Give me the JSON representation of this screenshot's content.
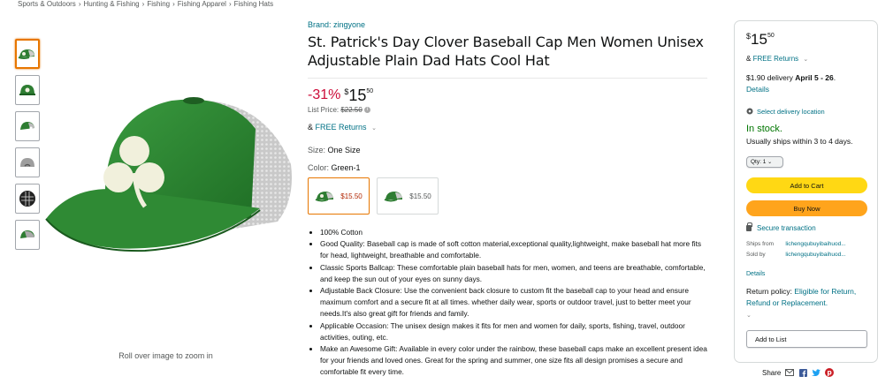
{
  "breadcrumb": [
    "Sports & Outdoors",
    "Hunting & Fishing",
    "Fishing",
    "Fishing Apparel",
    "Fishing Hats"
  ],
  "breadcrumb_sep": "›",
  "thumbnails": [
    "thumb-front",
    "thumb-clover",
    "thumb-side",
    "thumb-back",
    "thumb-inside",
    "thumb-back-gray"
  ],
  "main_image": {
    "rollover_text": "Roll over image to zoom in"
  },
  "product": {
    "brand": "Brand: zingyone",
    "title": "St. Patrick's Day Clover Baseball Cap Men Women Unisex Adjustable Plain Dad Hats Cool Hat",
    "discount": "-31%",
    "price_symbol": "$",
    "price_whole": "15",
    "price_fraction": "50",
    "list_price_label": "List Price:",
    "list_price": "$22.50",
    "returns_amp": "&",
    "returns_link": "FREE Returns",
    "size_label": "Size:",
    "size_value": "One Size",
    "color_label": "Color:",
    "color_value": "Green-1",
    "swatches": [
      {
        "price": "$15.50",
        "selected": true
      },
      {
        "price": "$15.50",
        "selected": false
      }
    ],
    "bullets": [
      "100% Cotton",
      "Good Quality: Baseball cap is made of soft cotton material,exceptional quality,lightweight, make baseball hat more fits for head, lightweight, breathable and comfortable.",
      "Classic Sports Ballcap: These comfortable plain baseball hats for men, women, and teens are breathable, comfortable, and keep the sun out of your eyes on sunny days.",
      "Adjustable Back Closure: Use the convenient back closure to custom fit the baseball cap to your head and ensure maximum comfort and a secure fit at all times. whether daily wear, sports or outdoor travel, just to better meet your needs.It's also great gift for friends and family.",
      "Applicable Occasion: The unisex design makes it fits for men and women for daily, sports, fishing, travel, outdoor activities, outing, etc.",
      "Make an Awesome Gift: Available in every color under the rainbow, these baseball caps make an excellent present idea for your friends and loved ones. Great for the spring and summer, one size fits all design promises a secure and comfortable fit every time."
    ]
  },
  "buybox": {
    "price_symbol": "$",
    "price_whole": "15",
    "price_fraction": "50",
    "returns_amp": "&",
    "returns_link": "FREE Returns",
    "delivery_prefix": "$1.90 delivery",
    "delivery_dates": "April 5 - 26",
    "delivery_suffix": ".",
    "details_link": "Details",
    "location_link": "Select delivery location",
    "stock": "In stock.",
    "ships": "Usually ships within 3 to 4 days.",
    "qty": "Qty: 1",
    "add_to_cart": "Add to Cart",
    "buy_now": "Buy Now",
    "secure": "Secure transaction",
    "ships_from_label": "Ships from",
    "ships_from_value": "lichengqubuyibaihuod...",
    "sold_by_label": "Sold by",
    "sold_by_value": "lichengqubuyibaihuod...",
    "details2": "Details",
    "policy_label": "Return policy:",
    "policy_link": "Eligible for Return, Refund or Replacement.",
    "add_to_list": "Add to List"
  },
  "share": {
    "label": "Share"
  },
  "colors": {
    "link": "#007185",
    "discount": "#cc0c39",
    "cart": "#ffd814",
    "buy": "#ffa41c",
    "stock": "#007600",
    "selected_border": "#e77600"
  }
}
